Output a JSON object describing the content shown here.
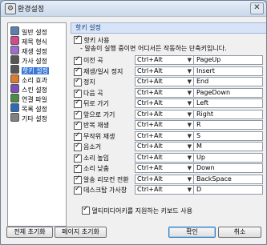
{
  "window": {
    "title": "환경설정"
  },
  "sidebar": {
    "items": [
      {
        "label": "일반 설정",
        "icon": "settings-icon",
        "color": "#5b7fb0"
      },
      {
        "label": "제목 형식",
        "icon": "format-icon",
        "color": "#d04a8c"
      },
      {
        "label": "재생 설정",
        "icon": "play-icon",
        "color": "#a06bd0"
      },
      {
        "label": "가사 설정",
        "icon": "lyrics-icon",
        "color": "#555555"
      },
      {
        "label": "핫키 설정",
        "icon": "hotkey-icon",
        "color": "#555555",
        "selected": true
      },
      {
        "label": "소리 효과",
        "icon": "sound-icon",
        "color": "#e07a28"
      },
      {
        "label": "스킨 설정",
        "icon": "skin-icon",
        "color": "#7a4fb8"
      },
      {
        "label": "연결 파일",
        "icon": "file-link-icon",
        "color": "#4a8a4a"
      },
      {
        "label": "목록 설정",
        "icon": "list-icon",
        "color": "#2a6ab8"
      },
      {
        "label": "기타 설정",
        "icon": "misc-icon",
        "color": "#808080"
      }
    ]
  },
  "panel": {
    "header": "핫키 설정",
    "use_hotkey": {
      "label": "핫키 사용",
      "checked": true
    },
    "hint": "- 알송이 실행 중이면 어디서든 작동하는 단축키입니다.",
    "rows": [
      {
        "label": "이전 곡",
        "modifier": "Ctrl+Alt",
        "key": "PageUp",
        "checked": true
      },
      {
        "label": "재생/일시 정지",
        "modifier": "Ctrl+Alt",
        "key": "Insert",
        "checked": true
      },
      {
        "label": "정지",
        "modifier": "Ctrl+Alt",
        "key": "End",
        "checked": true
      },
      {
        "label": "다음 곡",
        "modifier": "Ctrl+Alt",
        "key": "PageDown",
        "checked": true
      },
      {
        "label": "뒤로 가기",
        "modifier": "Ctrl+Alt",
        "key": "Left",
        "checked": true
      },
      {
        "label": "앞으로 가기",
        "modifier": "Ctrl+Alt",
        "key": "Right",
        "checked": true
      },
      {
        "label": "반복 재생",
        "modifier": "Ctrl+Alt",
        "key": "R",
        "checked": true
      },
      {
        "label": "무작위 재생",
        "modifier": "Ctrl+Alt",
        "key": "S",
        "checked": true
      },
      {
        "label": "음소거",
        "modifier": "Ctrl+Alt",
        "key": "M",
        "checked": true
      },
      {
        "label": "소리 높임",
        "modifier": "Ctrl+Alt",
        "key": "Up",
        "checked": true
      },
      {
        "label": "소리 낮춤",
        "modifier": "Ctrl+Alt",
        "key": "Down",
        "checked": true
      },
      {
        "label": "알송 리모컨 전환",
        "modifier": "Ctrl+Alt",
        "key": "BackSpace",
        "checked": true
      },
      {
        "label": "데스크탑 가사창",
        "modifier": "Ctrl+Alt",
        "key": "D",
        "checked": true
      }
    ],
    "multimedia": {
      "label": "멀티미디어키를 지원하는 키보드 사용",
      "checked": true
    }
  },
  "buttons": {
    "reset_all": "전체 초기화",
    "reset_page": "페이지 초기화",
    "ok": "확인",
    "cancel": "취소"
  }
}
